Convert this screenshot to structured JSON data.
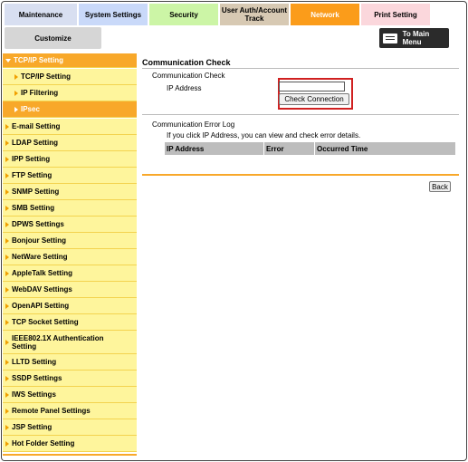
{
  "tabs": [
    {
      "label": "Maintenance"
    },
    {
      "label": "System Settings"
    },
    {
      "label": "Security"
    },
    {
      "label": "User Auth/Account Track"
    },
    {
      "label": "Network"
    },
    {
      "label": "Print Setting"
    }
  ],
  "customize_label": "Customize",
  "main_menu_label": "To Main Menu",
  "sidebar": {
    "items": [
      {
        "label": "TCP/IP Setting"
      },
      {
        "label": "TCP/IP Setting"
      },
      {
        "label": "IP Filtering"
      },
      {
        "label": "IPsec"
      },
      {
        "label": "E-mail Setting"
      },
      {
        "label": "LDAP Setting"
      },
      {
        "label": "IPP Setting"
      },
      {
        "label": "FTP Setting"
      },
      {
        "label": "SNMP Setting"
      },
      {
        "label": "SMB Setting"
      },
      {
        "label": "DPWS Settings"
      },
      {
        "label": "Bonjour Setting"
      },
      {
        "label": "NetWare Setting"
      },
      {
        "label": "AppleTalk Setting"
      },
      {
        "label": "WebDAV Settings"
      },
      {
        "label": "OpenAPI Setting"
      },
      {
        "label": "TCP Socket Setting"
      },
      {
        "label": "IEEE802.1X Authentication Setting"
      },
      {
        "label": "LLTD Setting"
      },
      {
        "label": "SSDP Settings"
      },
      {
        "label": "IWS Settings"
      },
      {
        "label": "Remote Panel Settings"
      },
      {
        "label": "JSP Setting"
      },
      {
        "label": "Hot Folder Setting"
      }
    ]
  },
  "content": {
    "title": "Communication Check",
    "section1_title": "Communication Check",
    "ip_label": "IP Address",
    "ip_value": "",
    "check_button": "Check Connection",
    "section2_title": "Communication Error Log",
    "hint": "If you click IP Address, you can view and check error details.",
    "table_headers": [
      "IP Address",
      "Error",
      "Occurred Time"
    ],
    "back_button": "Back"
  },
  "colors": {
    "accent": "#f8a82a",
    "sidebar_bg": "#fef59c",
    "highlight_box": "#d02020"
  }
}
